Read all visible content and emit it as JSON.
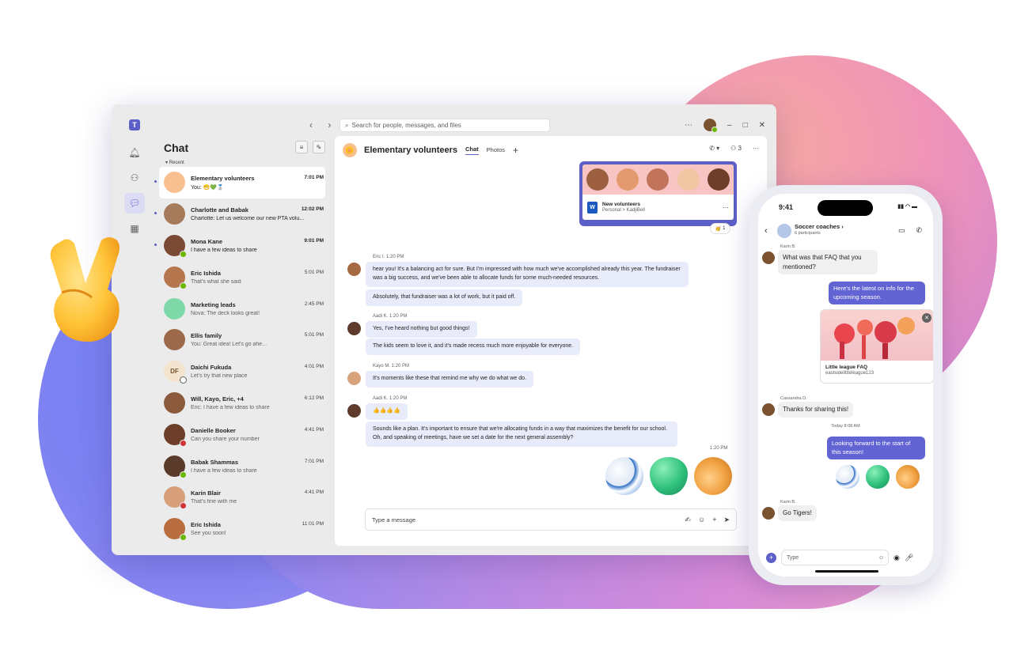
{
  "window": {
    "search_placeholder": "Search for people, messages, and files",
    "more": "⋯",
    "minimize": "–",
    "maximize": "□",
    "close": "✕"
  },
  "chatlist": {
    "title": "Chat",
    "section": "Recent",
    "items": [
      {
        "name": "Elementary volunteers",
        "time": "7:01 PM",
        "preview": "You: 😁💚🥈",
        "unread": true,
        "selected": true
      },
      {
        "name": "Charlotte and Babak",
        "time": "12:02 PM",
        "preview": "Charlotte: Let us welcome our new PTA volu...",
        "unread": true
      },
      {
        "name": "Mona Kane",
        "time": "9:01 PM",
        "preview": "I have a few ideas to share",
        "unread": true
      },
      {
        "name": "Eric Ishida",
        "time": "5:01 PM",
        "preview": "That's what she said"
      },
      {
        "name": "Marketing leads",
        "time": "2:45 PM",
        "preview": "Nova: The deck looks great!"
      },
      {
        "name": "Ellis family",
        "time": "5:01 PM",
        "preview": "You: Great idea! Let's go ahe..."
      },
      {
        "name": "Daichi Fukuda",
        "time": "4:01 PM",
        "preview": "Let's try that new place",
        "initials": "DF"
      },
      {
        "name": "Will, Kayo, Eric, +4",
        "time": "6:12 PM",
        "preview": "Eric: I have a few ideas to share"
      },
      {
        "name": "Danielle Booker",
        "time": "4:41 PM",
        "preview": "Can you share your number"
      },
      {
        "name": "Babak Shammas",
        "time": "7:01 PM",
        "preview": "I have a few ideas to share"
      },
      {
        "name": "Karin Blair",
        "time": "4:41 PM",
        "preview": "That's fine with me"
      },
      {
        "name": "Eric Ishida",
        "time": "11:01 PM",
        "preview": "See you soon!"
      }
    ]
  },
  "main": {
    "title": "Elementary volunteers",
    "tabs": [
      "Chat",
      "Photos"
    ],
    "participants": "3",
    "shared_file": {
      "title": "New volunteers",
      "path": "Personal > KadjiBell"
    },
    "reaction_count": "1",
    "messages": [
      {
        "meta": "Eric I.  1:20 PM",
        "bubbles": [
          "hear you! It's a balancing act for sure. But I'm impressed with how much we've accomplished already this year. The fundraiser was a big success, and we've been able to allocate funds for some much-needed resources.",
          "Absolutely, that fundraiser was a lot of work, but it paid off."
        ]
      },
      {
        "meta": "Aadi K.  1:20 PM",
        "bubbles": [
          "Yes, I've heard nothing but good things!",
          "The kids seem to love it, and it's made recess much more enjoyable for everyone."
        ]
      },
      {
        "meta": "Kayo M.  1:20 PM",
        "bubbles": [
          "It's moments like these that remind me why we do what we do."
        ]
      },
      {
        "meta": "Aadi K.  1:20 PM",
        "bubbles": [
          "👍👍👍👍",
          "Sounds like a plan. It's important to ensure that we're allocating funds in a way that maximizes the benefit for our school. Oh, and speaking of meetings, have we set a date for the next general assembly?"
        ]
      }
    ],
    "self_time": "1:20 PM",
    "composer_placeholder": "Type a message"
  },
  "phone": {
    "time": "9:41",
    "title": "Soccer coaches",
    "subtitle": "6 participants",
    "msg1_meta": "Karin B.",
    "msg1": "What was that FAQ that you mentioned?",
    "out1": "Here's the latest on info for the upcoming season.",
    "card_title": "Little league FAQ",
    "card_url": "eastsidelittleleague123",
    "msg2_meta": "Cassandra D.",
    "msg2": "Thanks for sharing this!",
    "date_sep": "Today 8:08 AM",
    "out2": "Looking forward to the start of this season!",
    "msg3_meta": "Karin B.",
    "msg3": "Go Tigers!",
    "composer_placeholder": "Type"
  },
  "colors": {
    "accent": "#5b5fc7",
    "bubble": "#e8ebfa",
    "available": "#6bb700",
    "busy": "#d13438"
  }
}
